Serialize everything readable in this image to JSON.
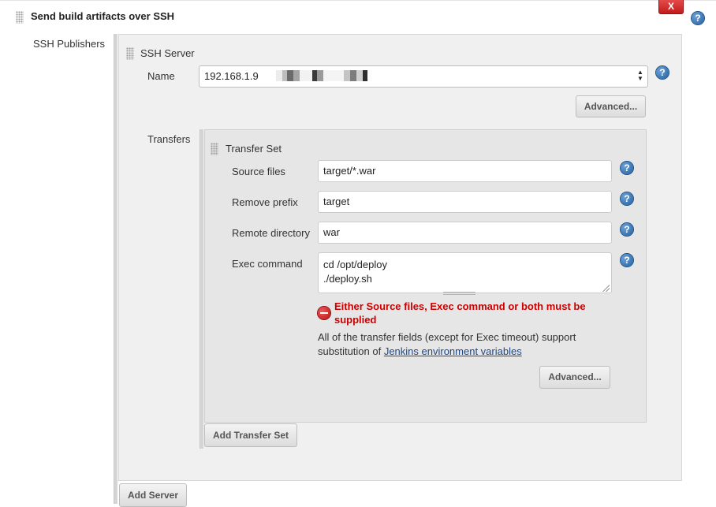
{
  "header": {
    "title": "Send build artifacts over SSH",
    "delete_label": "X"
  },
  "publishers": {
    "label": "SSH Publishers",
    "server": {
      "section_title": "SSH Server",
      "name_label": "Name",
      "name_value": "192.168.1.9",
      "advanced_label": "Advanced..."
    },
    "transfers_label": "Transfers",
    "transfer_set": {
      "title": "Transfer Set",
      "source_files_label": "Source files",
      "source_files_value": "target/*.war",
      "remove_prefix_label": "Remove prefix",
      "remove_prefix_value": "target",
      "remote_directory_label": "Remote directory",
      "remote_directory_value": "war",
      "exec_command_label": "Exec command",
      "exec_command_lines": [
        "cd /opt/deploy",
        "./deploy.sh"
      ],
      "error_line1": "Either Source files, Exec command or both must be",
      "error_line2": "supplied",
      "note_line1": "All of the transfer fields (except for Exec timeout) support",
      "note_line2_prefix": "substitution of ",
      "note_link": "Jenkins environment variables",
      "advanced_label": "Advanced..."
    },
    "add_transfer_set_label": "Add Transfer Set",
    "add_server_label": "Add Server"
  },
  "colors": {
    "delete_button": "#cc1f1f",
    "error_text": "#cc0000",
    "link": "#204a87",
    "help_icon": "#2a6cb0",
    "panel_bg": "#f0f0f0",
    "inner_panel_bg": "#e6e6e6"
  },
  "icons": [
    "drag-handle-icon",
    "help-icon",
    "error-icon",
    "select-arrows-icon"
  ]
}
